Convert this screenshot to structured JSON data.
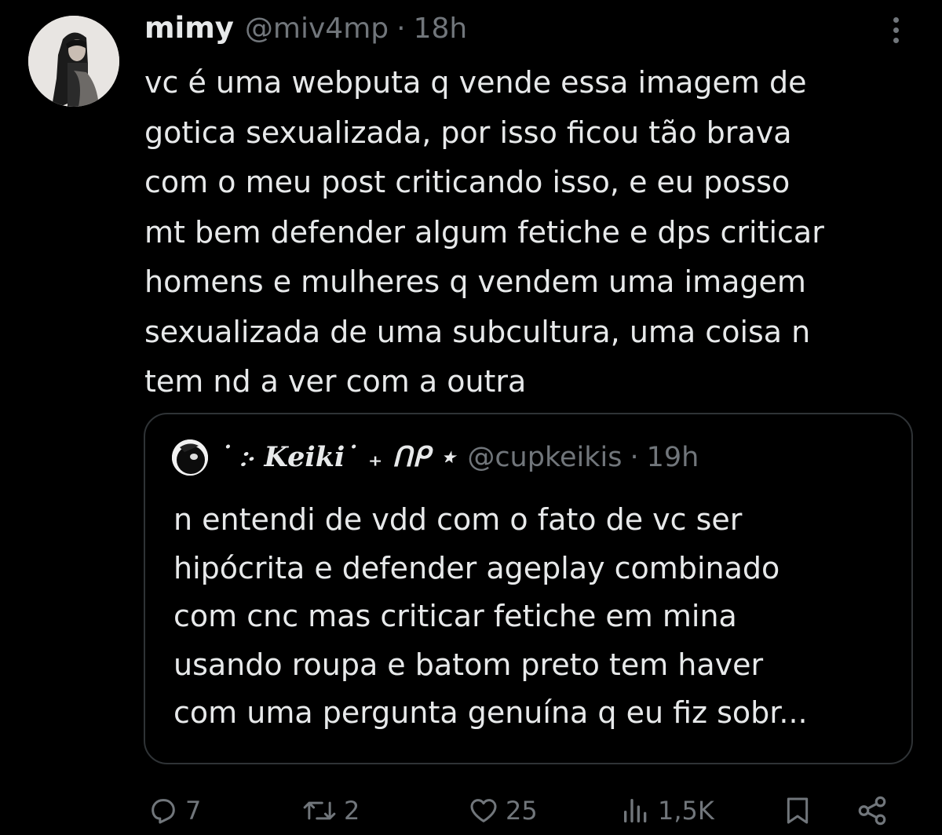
{
  "tweet": {
    "display_name": "mimy",
    "handle": "@miv4mp",
    "separator": "·",
    "time": "18h",
    "avatar_icon": "profile-photo",
    "more_icon": "more-vertical-icon",
    "text": "vc é uma webputa q vende essa imagem de\ngotica sexualizada, por isso ficou tão brava\ncom o meu post criticando isso, e eu posso\nmt bem defender algum fetiche e dps criticar\nhomens e mulheres q vendem uma imagem\nsexualizada de uma subcultura, uma coisa n\ntem nd a ver com a outra"
  },
  "quoted_tweet": {
    "display_name": "˙ ჻ Keiki˙ ₊ ᑎᑭ ⋆",
    "handle": "@cupkeikis",
    "separator": "·",
    "time": "19h",
    "avatar_icon": "profile-photo",
    "text": "n entendi de vdd com o fato de vc ser\nhipócrita e defender ageplay combinado\ncom cnc mas criticar fetiche em mina\nusando roupa e batom preto tem haver\ncom uma pergunta genuína q eu fiz sobr..."
  },
  "actions": {
    "reply": {
      "icon": "reply-icon",
      "count": "7"
    },
    "retweet": {
      "icon": "retweet-icon",
      "count": "2"
    },
    "like": {
      "icon": "heart-icon",
      "count": "25"
    },
    "views": {
      "icon": "views-icon",
      "count": "1,5K"
    },
    "bookmark": {
      "icon": "bookmark-icon"
    },
    "share": {
      "icon": "share-icon"
    }
  },
  "colors": {
    "background": "#000000",
    "text_primary": "#e7e9ea",
    "text_secondary": "#71767b",
    "border": "#2f3336"
  }
}
